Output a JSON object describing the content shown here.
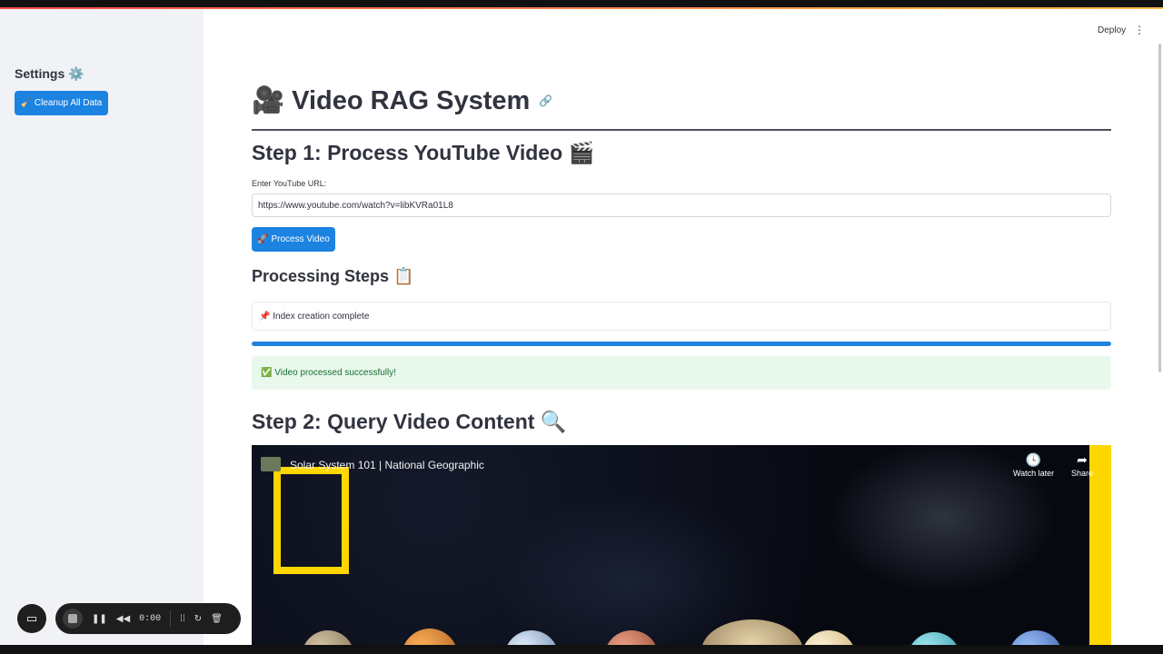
{
  "sidebar": {
    "title": "Settings ⚙️",
    "cleanup_button": "🧹 Cleanup All Data"
  },
  "header": {
    "deploy_label": "Deploy",
    "menu_icon": "kebab-menu-icon"
  },
  "main": {
    "title": "🎥 Video RAG System",
    "title_link_icon": "link-icon",
    "step1_heading": "Step 1: Process YouTube Video 🎬",
    "url_label": "Enter YouTube URL:",
    "url_value": "https://www.youtube.com/watch?v=libKVRa01L8",
    "process_button": "🚀 Process Video",
    "processing_heading": "Processing Steps 📋",
    "status_text": "📌 Index creation complete",
    "progress": 1.0,
    "success_text": "✅ Video processed successfully!",
    "step2_heading": "Step 2: Query Video Content 🔍"
  },
  "video": {
    "title": "Solar System 101 | National Geographic",
    "watch_later_label": "Watch later",
    "share_label": "Share"
  },
  "recorder": {
    "time": "0:00"
  },
  "colors": {
    "primary": "#1c83e1",
    "success_bg": "#e9f8ec",
    "success_text": "#177233",
    "sidebar_bg": "#f0f2f6",
    "natgeo_yellow": "#ffd700"
  }
}
